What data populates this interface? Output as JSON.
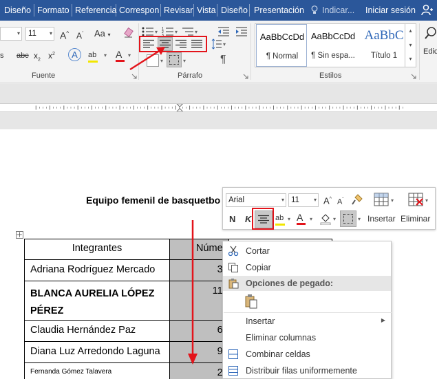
{
  "tabs": [
    "Diseño",
    "Formato",
    "Referencia",
    "Correspon",
    "Revisar",
    "Vista",
    "Diseño",
    "Presentación"
  ],
  "tell_me": "Indicar...",
  "sign_in": "Iniciar sesión",
  "ribbon": {
    "font_size": "11",
    "groups": {
      "font": "Fuente",
      "paragraph": "Párrafo",
      "styles": "Estilos"
    },
    "styles": [
      {
        "preview": "AaBbCcDd",
        "name": "¶ Normal"
      },
      {
        "preview": "AaBbCcDd",
        "name": "¶ Sin espa..."
      },
      {
        "preview": "AaBbC",
        "name": "Título 1"
      }
    ],
    "edit_label": "Edic"
  },
  "document": {
    "title": "Equipo femenil de basquetbo",
    "table": {
      "headers": [
        "Integrantes",
        "Núme"
      ],
      "rows": [
        {
          "name": "Adriana Rodríguez Mercado",
          "num": "3"
        },
        {
          "name": "BLANCA AURELIA LÓPEZ PÉREZ",
          "num": "11"
        },
        {
          "name": "Claudia Hernández Paz",
          "num": "6"
        },
        {
          "name": "Diana Luz Arredondo Laguna",
          "num": "9"
        },
        {
          "name": "Fernanda Gómez Talavera",
          "num": "2"
        }
      ]
    }
  },
  "mini_toolbar": {
    "font": "Arial",
    "size": "11",
    "insert_label": "Insertar",
    "delete_label": "Eliminar"
  },
  "context_menu": {
    "cut": "Cortar",
    "copy": "Copiar",
    "paste_options": "Opciones de pegado:",
    "insert": "Insertar",
    "delete_columns": "Eliminar columnas",
    "merge_cells": "Combinar celdas",
    "distribute_rows": "Distribuir filas uniformemente"
  },
  "colors": {
    "tab_bar": "#2b579a",
    "annotation_red": "#e3141b",
    "shaded_column": "#bfbfbf"
  }
}
